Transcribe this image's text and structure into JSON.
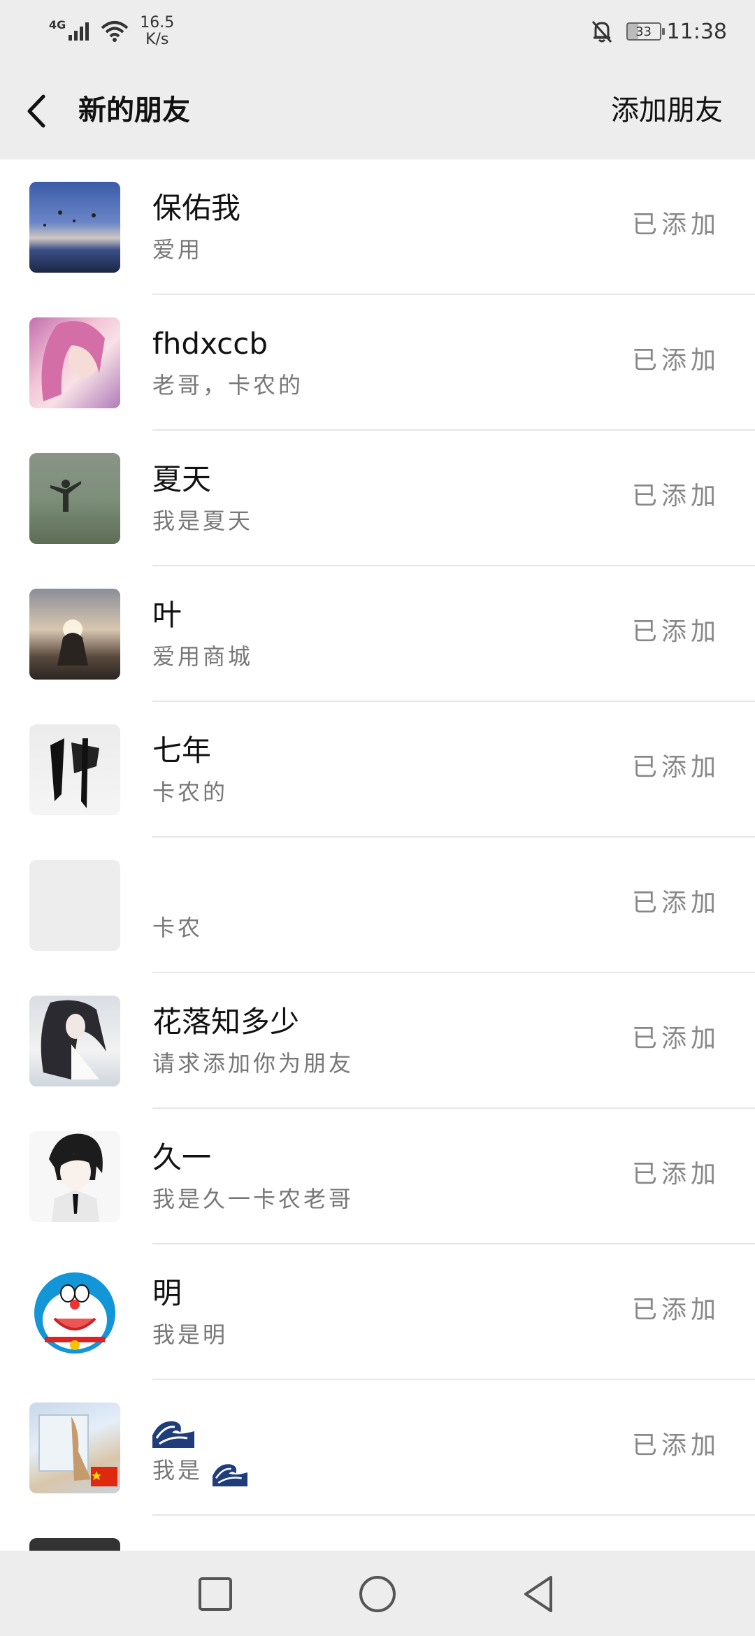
{
  "status_bar": {
    "network": "4G",
    "speed_value": "16.5",
    "speed_unit": "K/s",
    "battery": "33",
    "time": "11:38"
  },
  "header": {
    "title": "新的朋友",
    "action": "添加朋友"
  },
  "friends": [
    {
      "name": "保佑我",
      "message": "爱用",
      "status": "已添加",
      "avatar": "sky-balloons"
    },
    {
      "name": "fhdxccb",
      "message": "老哥，卡农的",
      "status": "已添加",
      "avatar": "pink-hair-girl"
    },
    {
      "name": "夏天",
      "message": "我是夏天",
      "status": "已添加",
      "avatar": "person-at-sea"
    },
    {
      "name": "叶",
      "message": "爱用商城",
      "status": "已添加",
      "avatar": "sunset-silhouette"
    },
    {
      "name": "七年",
      "message": "卡农的",
      "status": "已添加",
      "avatar": "ink-calligraphy"
    },
    {
      "name": "",
      "message": "卡农",
      "status": "已添加",
      "avatar": "blank"
    },
    {
      "name": "花落知多少",
      "message": "请求添加你为朋友",
      "status": "已添加",
      "avatar": "anime-long-hair"
    },
    {
      "name": "久一",
      "message": "我是久一卡农老哥",
      "status": "已添加",
      "avatar": "anime-boy-sketch"
    },
    {
      "name": "明",
      "message": "我是明",
      "status": "已添加",
      "avatar": "doraemon"
    },
    {
      "name": "",
      "message": "我是",
      "status": "已添加",
      "avatar": "photo-with-flag",
      "name_icon": "wave-emoji",
      "message_icon": "wave-emoji"
    }
  ],
  "colors": {
    "bar_background": "#ededed",
    "list_background": "#ffffff",
    "primary_text": "#111111",
    "secondary_text": "#777777",
    "status_text": "#888888",
    "divider": "#e6e6e6"
  }
}
